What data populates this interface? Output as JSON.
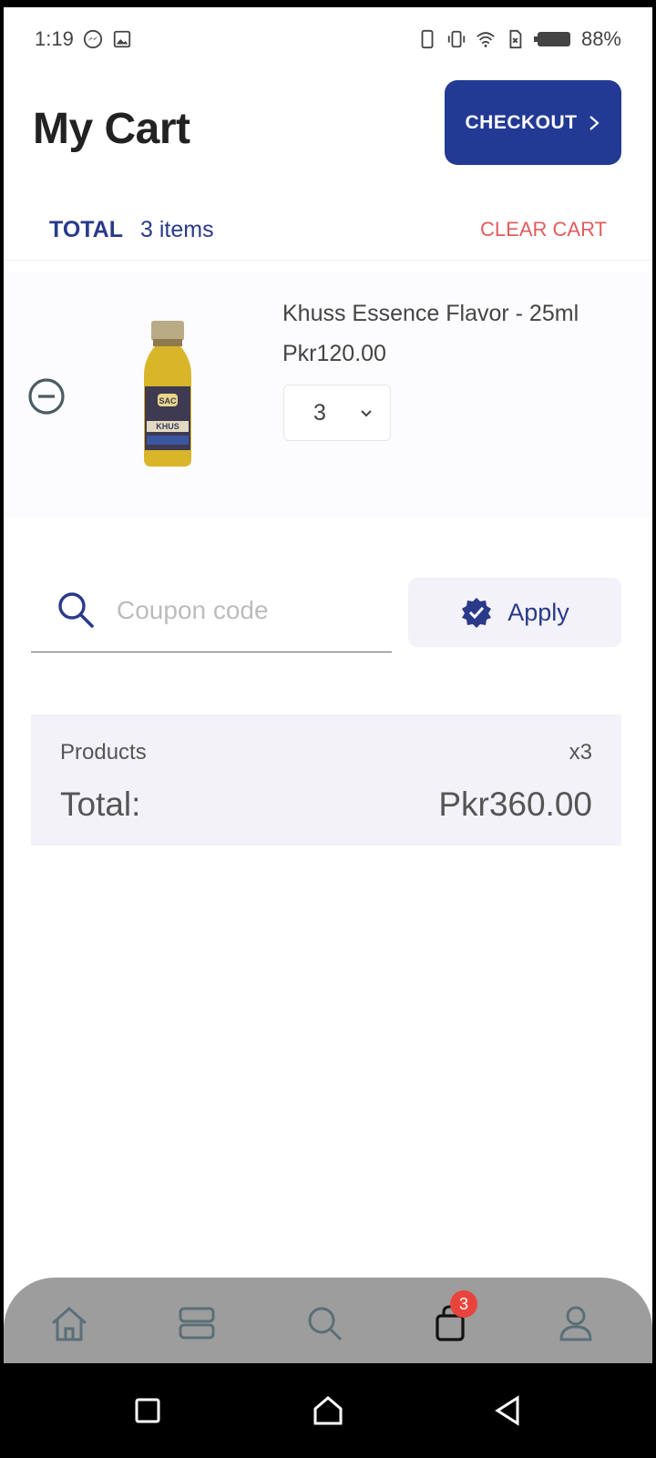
{
  "status_bar": {
    "time": "1:19",
    "battery": "88%"
  },
  "header": {
    "title": "My Cart",
    "checkout_label": "CHECKOUT"
  },
  "summary_bar": {
    "total_label": "TOTAL",
    "items_text": "3 items",
    "clear_label": "CLEAR CART"
  },
  "cart_items": [
    {
      "name": "Khuss Essence Flavor - 25ml",
      "price": "Pkr120.00",
      "quantity": "3",
      "image_labels": [
        "SAC",
        "KHUS"
      ]
    }
  ],
  "coupon": {
    "placeholder": "Coupon code",
    "value": "",
    "apply_label": "Apply"
  },
  "order_summary": {
    "products_label": "Products",
    "products_count": "x3",
    "total_label": "Total:",
    "total_value": "Pkr360.00"
  },
  "bottom_nav": {
    "items": [
      "home-icon",
      "categories-icon",
      "search-icon",
      "cart-icon",
      "profile-icon"
    ],
    "cart_badge": "3"
  },
  "colors": {
    "primary": "#233a94",
    "danger": "#e25c5c",
    "badge": "#e9443b",
    "nav_bg": "#9d9d9d",
    "summary_bg": "#f3f2f8"
  }
}
